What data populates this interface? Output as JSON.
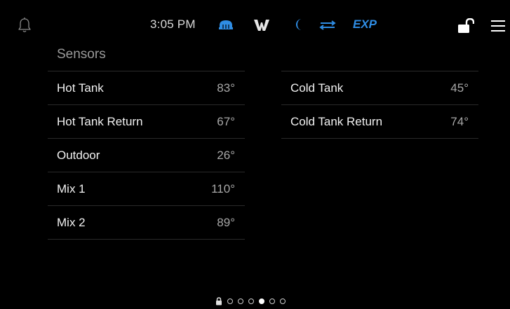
{
  "status_bar": {
    "time": "3:05 PM",
    "mode_label": "EXP",
    "icons": [
      "bell-icon",
      "heat-icon",
      "w-icon",
      "moon-icon",
      "swap-icon",
      "unlock-icon",
      "menu-icon"
    ],
    "accent_color": "#2f8de4"
  },
  "sensors": {
    "title": "Sensors",
    "left": [
      {
        "name": "Hot Tank",
        "value": "83°"
      },
      {
        "name": "Hot Tank Return",
        "value": "67°"
      },
      {
        "name": "Outdoor",
        "value": "26°"
      },
      {
        "name": "Mix 1",
        "value": "110°"
      },
      {
        "name": "Mix 2",
        "value": "89°"
      }
    ],
    "right": [
      {
        "name": "Cold Tank",
        "value": "45°"
      },
      {
        "name": "Cold Tank Return",
        "value": "74°"
      }
    ]
  },
  "pager": {
    "page_count": 6,
    "active_page": 4
  }
}
